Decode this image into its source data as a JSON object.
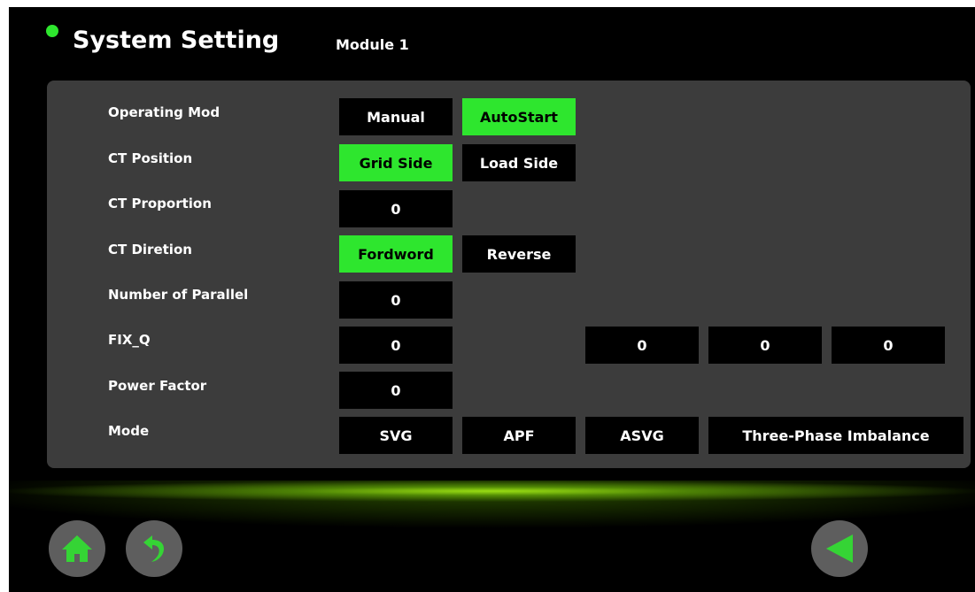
{
  "header": {
    "title": "System Setting",
    "module": "Module 1"
  },
  "colors": {
    "accent": "#2ee62e",
    "panel": "#3c3c3c",
    "button_off": "#000000"
  },
  "settings": {
    "operating_mode": {
      "label": "Operating Mod",
      "options": [
        "Manual",
        "AutoStart"
      ],
      "selected": "AutoStart"
    },
    "ct_position": {
      "label": "CT Position",
      "options": [
        "Grid Side",
        "Load Side"
      ],
      "selected": "Grid Side"
    },
    "ct_proportion": {
      "label": "CT Proportion",
      "value": "0"
    },
    "ct_direction": {
      "label": "CT Diretion",
      "options": [
        "Fordword",
        "Reverse"
      ],
      "selected": "Fordword"
    },
    "number_of_parallel": {
      "label": "Number of Parallel",
      "value": "0"
    },
    "fix_q": {
      "label": "FIX_Q",
      "value": "0",
      "phase_values": [
        "0",
        "0",
        "0"
      ]
    },
    "power_factor": {
      "label": "Power Factor",
      "value": "0"
    },
    "mode": {
      "label": "Mode",
      "options": [
        "SVG",
        "APF",
        "ASVG",
        "Three-Phase Imbalance"
      ]
    }
  },
  "footer": {
    "icons": [
      "home-icon",
      "undo-icon",
      "back-triangle-icon"
    ]
  }
}
